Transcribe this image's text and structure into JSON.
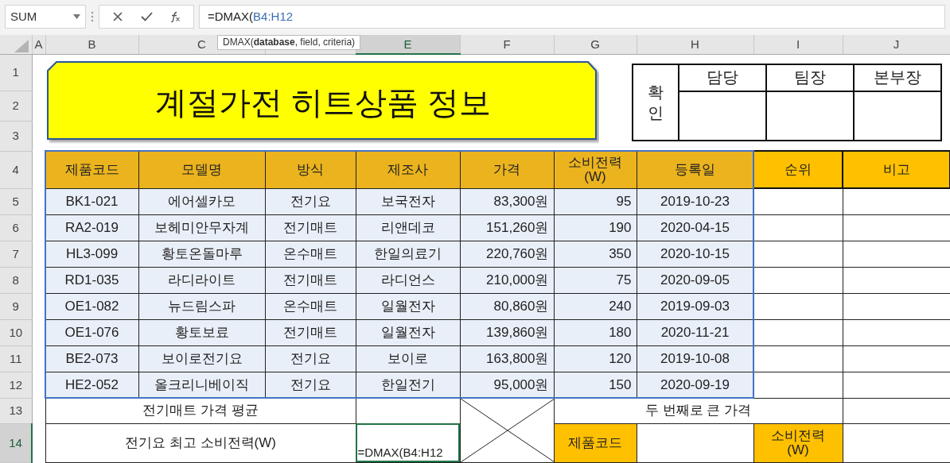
{
  "name_box": {
    "value": "SUM"
  },
  "formula_bar": {
    "prefix": "=DMAX(",
    "reference": "B4:H12"
  },
  "tooltip": "DMAX(**database**, field, criteria)",
  "columns": [
    {
      "label": "A",
      "selected": false
    },
    {
      "label": "B",
      "selected": false
    },
    {
      "label": "C",
      "selected": false
    },
    {
      "selected": false
    },
    {
      "label": "E",
      "selected": true
    },
    {
      "label": "F",
      "selected": false
    },
    {
      "label": "G",
      "selected": false
    },
    {
      "label": "H",
      "selected": false
    },
    {
      "label": "I",
      "selected": false
    },
    {
      "label": "J",
      "selected": false
    }
  ],
  "row_numbers": [
    {
      "label": "1",
      "selected": false
    },
    {
      "label": "2",
      "selected": false
    },
    {
      "label": "3",
      "selected": false
    },
    {
      "label": "4",
      "selected": false
    },
    {
      "label": "5",
      "selected": false
    },
    {
      "label": "6",
      "selected": false
    },
    {
      "label": "7",
      "selected": false
    },
    {
      "label": "8",
      "selected": false
    },
    {
      "label": "9",
      "selected": false
    },
    {
      "label": "10",
      "selected": false
    },
    {
      "label": "11",
      "selected": false
    },
    {
      "label": "12",
      "selected": false
    },
    {
      "label": "13",
      "selected": false
    },
    {
      "label": "14",
      "selected": true
    }
  ],
  "title": "계절가전 히트상품 정보",
  "approval": {
    "label": "확인",
    "roles": [
      "담당",
      "팀장",
      "본부장"
    ]
  },
  "table": {
    "columns": [
      {
        "label": "제품코드",
        "color": "#ebb31e"
      },
      {
        "label": "모델명",
        "color": "#ebb31e"
      },
      {
        "label": "방식",
        "color": "#ebb31e"
      },
      {
        "label": "제조사",
        "color": "#ebb31e"
      },
      {
        "label": "가격",
        "color": "#ebb31e"
      },
      {
        "label": "소비전력\n(W)",
        "color": "#ebb31e"
      },
      {
        "label": "등록일",
        "color": "#ebb31e"
      },
      {
        "label": "순위",
        "color": "#ffc000"
      },
      {
        "label": "비고",
        "color": "#ffc000"
      }
    ],
    "rows": [
      [
        "BK1-021",
        "에어셀카모",
        "전기요",
        "보국전자",
        "83,300원",
        "95",
        "2019-10-23"
      ],
      [
        "RA2-019",
        "보헤미안무자계",
        "전기매트",
        "리앤데코",
        "151,260원",
        "190",
        "2020-04-15"
      ],
      [
        "HL3-099",
        "황토온돌마루",
        "온수매트",
        "한일의료기",
        "220,760원",
        "350",
        "2020-10-15"
      ],
      [
        "RD1-035",
        "라디라이트",
        "전기매트",
        "라디언스",
        "210,000원",
        "75",
        "2020-09-05"
      ],
      [
        "OE1-082",
        "뉴드림스파",
        "온수매트",
        "일월전자",
        "80,860원",
        "240",
        "2019-09-03"
      ],
      [
        "OE1-076",
        "황토보료",
        "전기매트",
        "일월전자",
        "139,860원",
        "180",
        "2020-11-21"
      ],
      [
        "BE2-073",
        "보이로전기요",
        "전기요",
        "보이로",
        "163,800원",
        "120",
        "2019-10-08"
      ],
      [
        "HE2-052",
        "올크리니베이직",
        "전기요",
        "한일전기",
        "95,000원",
        "150",
        "2020-09-19"
      ]
    ]
  },
  "summary": {
    "average_label": "전기매트 가격 평균",
    "second_price_label": "두 번째로 큰 가격",
    "max_power_label": "전기요 최고 소비전력(W)",
    "editing_cell": "=DMAX(B4:H12",
    "code_label": "제품코드",
    "power_label": "소비전력\n(W)"
  }
}
